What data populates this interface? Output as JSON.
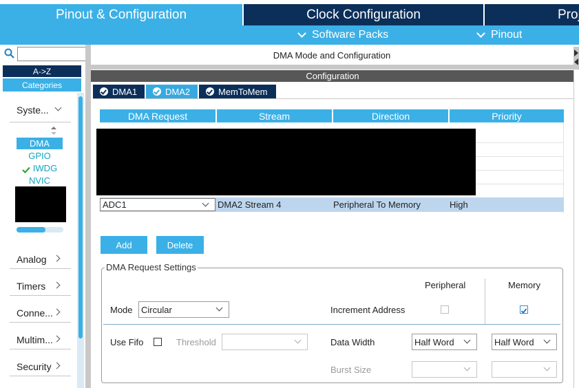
{
  "header": {
    "tabs": [
      {
        "label": "Pinout & Configuration",
        "active": true
      },
      {
        "label": "Clock Configuration",
        "active": false
      },
      {
        "label": "Proj",
        "active": false
      }
    ],
    "sub_menu": [
      {
        "label": "Software Packs"
      },
      {
        "label": "Pinout"
      }
    ]
  },
  "sidebar": {
    "search": {
      "value": "",
      "placeholder": ""
    },
    "sort_label": "A->Z",
    "categories_label": "Categories",
    "system_core": {
      "label": "Syste...",
      "items": [
        {
          "label": "DMA",
          "selected": true,
          "checked": false
        },
        {
          "label": "GPIO",
          "selected": false,
          "checked": false
        },
        {
          "label": "IWDG",
          "selected": false,
          "checked": true
        },
        {
          "label": "NVIC",
          "selected": false,
          "checked": false
        }
      ]
    },
    "categories": [
      {
        "label": "Analog"
      },
      {
        "label": "Timers"
      },
      {
        "label": "Conne..."
      },
      {
        "label": "Multim..."
      },
      {
        "label": "Security"
      }
    ]
  },
  "main": {
    "title": "DMA Mode and Configuration",
    "config_label": "Configuration",
    "tabs": [
      {
        "label": "DMA1",
        "active": false
      },
      {
        "label": "DMA2",
        "active": true
      },
      {
        "label": "MemToMem",
        "active": false
      }
    ],
    "table": {
      "columns": [
        "DMA Request",
        "Stream",
        "Direction",
        "Priority"
      ],
      "selected_row": {
        "request": "ADC1",
        "stream": "DMA2 Stream 4",
        "direction": "Peripheral To Memory",
        "priority": "High"
      }
    },
    "buttons": {
      "add": "Add",
      "delete": "Delete"
    },
    "settings": {
      "title": "DMA Request Settings",
      "peripheral_label": "Peripheral",
      "memory_label": "Memory",
      "mode_label": "Mode",
      "mode_value": "Circular",
      "increment_label": "Increment Address",
      "peripheral_increment": false,
      "memory_increment": true,
      "use_fifo_label": "Use Fifo",
      "threshold_label": "Threshold",
      "threshold_value": "",
      "data_width_label": "Data Width",
      "peripheral_width": "Half Word",
      "memory_width": "Half Word",
      "burst_label": "Burst Size",
      "peripheral_burst": "",
      "memory_burst": ""
    }
  },
  "colors": {
    "accent": "#3bb0e6",
    "navy": "#0c2f5a",
    "row_selected": "#bdd6ee",
    "item_text": "#15a3c0"
  }
}
